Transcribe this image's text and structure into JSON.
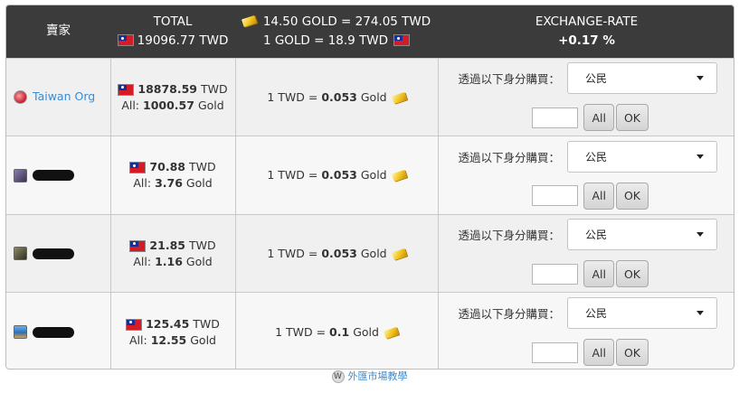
{
  "header": {
    "seller_col": "賣家",
    "total_label": "TOTAL",
    "total_value": "19096.77 TWD",
    "gold_line1": "14.50 GOLD = 274.05 TWD",
    "gold_line2": "1 GOLD = 18.9 TWD",
    "rate_label": "EXCHANGE-RATE",
    "rate_value": "+0.17 %"
  },
  "offers": [
    {
      "seller": "Taiwan Org",
      "amount": "18878.59",
      "currency": "TWD",
      "all_label": "All:",
      "all_gold": "1000.57",
      "gold_unit": "Gold",
      "rate_prefix": "1 TWD =",
      "rate": "0.053",
      "rate_unit": "Gold",
      "buy_label": "透過以下身分購買：",
      "buy_as": "公民",
      "all_btn": "All",
      "ok_btn": "OK"
    },
    {
      "seller": "",
      "amount": "70.88",
      "currency": "TWD",
      "all_label": "All:",
      "all_gold": "3.76",
      "gold_unit": "Gold",
      "rate_prefix": "1 TWD =",
      "rate": "0.053",
      "rate_unit": "Gold",
      "buy_label": "透過以下身分購買：",
      "buy_as": "公民",
      "all_btn": "All",
      "ok_btn": "OK"
    },
    {
      "seller": "",
      "amount": "21.85",
      "currency": "TWD",
      "all_label": "All:",
      "all_gold": "1.16",
      "gold_unit": "Gold",
      "rate_prefix": "1 TWD =",
      "rate": "0.053",
      "rate_unit": "Gold",
      "buy_label": "透過以下身分購買：",
      "buy_as": "公民",
      "all_btn": "All",
      "ok_btn": "OK"
    },
    {
      "seller": "",
      "amount": "125.45",
      "currency": "TWD",
      "all_label": "All:",
      "all_gold": "12.55",
      "gold_unit": "Gold",
      "rate_prefix": "1 TWD =",
      "rate": "0.1",
      "rate_unit": "Gold",
      "buy_label": "透過以下身分購買：",
      "buy_as": "公民",
      "all_btn": "All",
      "ok_btn": "OK"
    }
  ],
  "footer": {
    "link": "外匯市場教學"
  }
}
